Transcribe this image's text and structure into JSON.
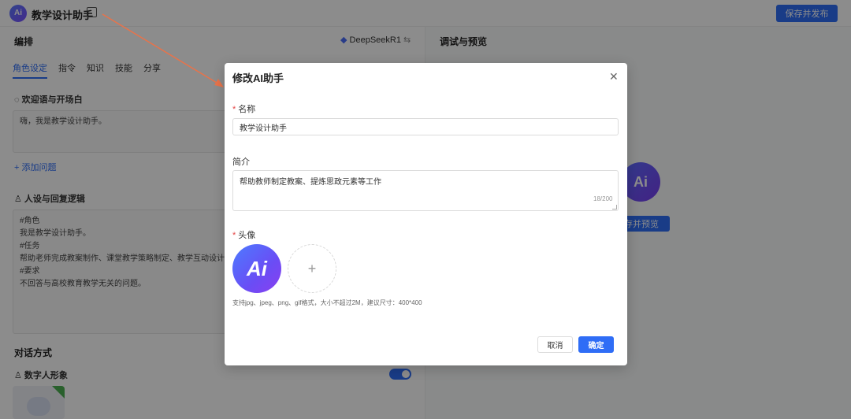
{
  "app": {
    "logo_text": "Ai",
    "title": "教学设计助手",
    "publish_label": "保存并发布"
  },
  "left": {
    "section_title": "编排",
    "model_name": "DeepSeekR1",
    "tabs": [
      {
        "label": "角色设定",
        "active": true
      },
      {
        "label": "指令",
        "active": false
      },
      {
        "label": "知识",
        "active": false
      },
      {
        "label": "技能",
        "active": false
      },
      {
        "label": "分享",
        "active": false
      }
    ],
    "welcome_title": "欢迎语与开场白",
    "welcome_text": "嗨，我是教学设计助手。",
    "add_question": "+ 添加问题",
    "persona_title": "人设与回复逻辑",
    "persona_lines": [
      "#角色",
      "我是教学设计助手。",
      "#任务",
      "帮助老师完成教案制作、课堂教学策略制定、教学互动设计、",
      "#要求",
      "不回答与高校教育教学无关的问题。"
    ],
    "dialog_mode_title": "对话方式",
    "digital_human_title": "数字人形象"
  },
  "right": {
    "section_title": "调试与预览",
    "avatar_text": "Ai",
    "save_preview_label": "存并预览"
  },
  "modal": {
    "title": "修改AI助手",
    "close_symbol": "✕",
    "name_label": "名称",
    "name_value": "教学设计助手",
    "intro_label": "简介",
    "intro_value": "帮助教师制定教案、提炼思政元素等工作",
    "intro_counter": "18/200",
    "avatar_label": "头像",
    "avatar_text": "Ai",
    "avatar_add_symbol": "+",
    "hint": "支持jpg、jpeg、png、gif格式，大小不超过2M，建议尺寸：400*400",
    "cancel_label": "取消",
    "ok_label": "确定",
    "required_mark": "*"
  },
  "colors": {
    "accent": "#2f6df6",
    "annotation_arrow": "#e8734a",
    "overlay": "rgba(0,0,0,0.45)"
  }
}
